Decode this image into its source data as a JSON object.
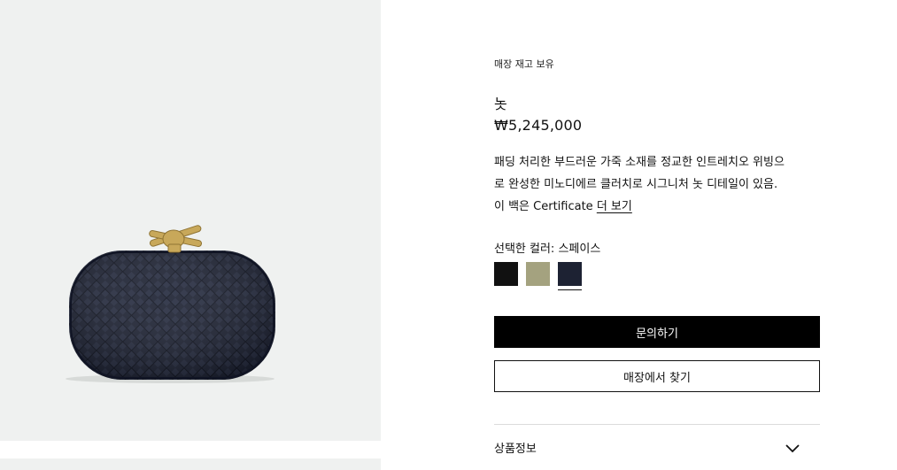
{
  "product": {
    "stock_status": "매장 재고 보유",
    "name": "놋",
    "price": "₩5,245,000",
    "description_line1": "패딩 처리한 부드러운 가죽 소재를 정교한 인트레치오 위빙으",
    "description_line2": "로 완성한 미노디에르 클러치로 시그니처 놋 디테일이 있음.",
    "description_line3": "이 백은 Certificate",
    "description_more": "더 보기"
  },
  "colors": {
    "label": "선택한 컬러: 스페이스",
    "options": [
      {
        "name": "black",
        "hex": "#111111",
        "selected": false
      },
      {
        "name": "beige",
        "hex": "#a4a27f",
        "selected": false
      },
      {
        "name": "space",
        "hex": "#1d2233",
        "selected": true
      }
    ]
  },
  "actions": {
    "inquire_label": "문의하기",
    "find_store_label": "매장에서 찾기"
  },
  "accordion": {
    "product_info_label": "상품정보"
  },
  "gallery": {
    "background": "#eff1f0",
    "bag_color": "#1d2233",
    "knot_color": "#c8a85a"
  }
}
